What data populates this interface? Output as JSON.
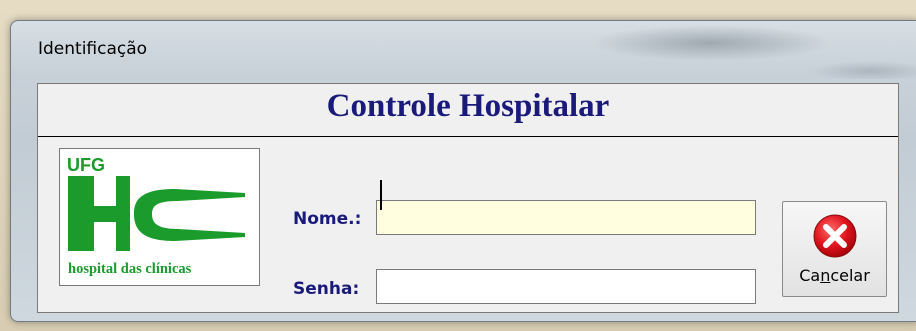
{
  "window": {
    "title": "Identificação"
  },
  "header": {
    "title": "Controle Hospitalar"
  },
  "logo": {
    "top_text": "UFG",
    "bottom_text": "hospital das clínicas",
    "color": "#1a9b2c"
  },
  "form": {
    "name_label": "Nome.:",
    "name_value": "",
    "password_label": "Senha:",
    "password_value": ""
  },
  "buttons": {
    "cancel": {
      "label_before": "Ca",
      "label_accel": "n",
      "label_after": "celar",
      "icon": "close-icon",
      "icon_color": "#e0141e"
    }
  },
  "colors": {
    "label_navy": "#1a1a7a",
    "name_field_bg": "#ffffe0"
  }
}
